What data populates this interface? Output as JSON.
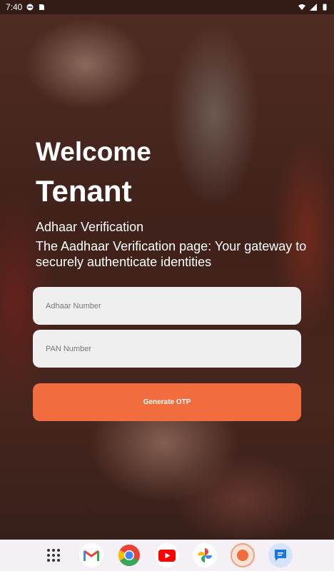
{
  "status_bar": {
    "time": "7:40",
    "left_icons": [
      "vpn-icon",
      "sim-icon"
    ],
    "right_icons": [
      "wifi-icon",
      "signal-icon",
      "battery-icon"
    ]
  },
  "page": {
    "welcome": "Welcome",
    "role": "Tenant",
    "subtitle": "Adhaar Verification",
    "description": "The Aadhaar Verification page: Your gateway to securely authenticate identities"
  },
  "form": {
    "aadhaar_placeholder": "Adhaar Number",
    "pan_placeholder": "PAN Number",
    "submit_label": "Generate OTP"
  },
  "colors": {
    "accent": "#f26d3d",
    "field_bg": "#efefef"
  },
  "dock": {
    "apps": [
      "app-drawer-icon",
      "gmail-icon",
      "chrome-icon",
      "youtube-icon",
      "photos-icon",
      "app-icon",
      "messages-icon"
    ]
  }
}
